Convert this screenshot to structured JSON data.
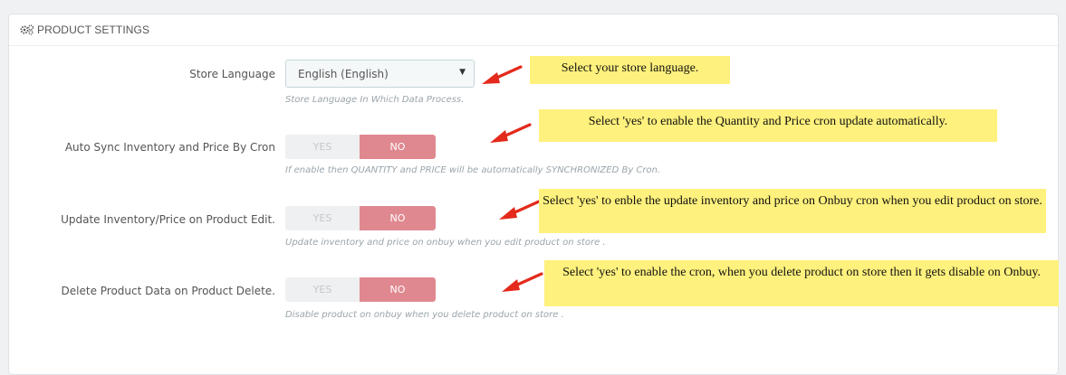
{
  "panel": {
    "title": "PRODUCT SETTINGS",
    "icon": "gears-icon"
  },
  "store_language": {
    "label": "Store Language",
    "selected": "English (English)",
    "help": "Store Language In Which Data Process.",
    "note": "Select your store language."
  },
  "auto_sync": {
    "label": "Auto Sync Inventory and Price By Cron",
    "yes": "YES",
    "no": "NO",
    "selected": "NO",
    "help": "If enable then QUANTITY and PRICE will be automatically SYNCHRONIZED By Cron.",
    "note": "Select 'yes' to enable the Quantity and Price cron update automatically."
  },
  "update_inventory": {
    "label": "Update Inventory/Price on Product Edit.",
    "yes": "YES",
    "no": "NO",
    "selected": "NO",
    "help": "Update inventory and price on onbuy when you edit product on store .",
    "note": "Select 'yes' to enble the update inventory and price on Onbuy cron when you edit product on store."
  },
  "delete_product": {
    "label": "Delete Product Data on Product Delete.",
    "yes": "YES",
    "no": "NO",
    "selected": "NO",
    "help": "Disable product on onbuy when you delete product on store .",
    "note": "Select 'yes' to enable the cron, when you delete product on store then it gets disable on Onbuy."
  },
  "colors": {
    "note_bg": "#fff17d",
    "arrow": "#e32a1c",
    "switch_no": "#e08890"
  }
}
